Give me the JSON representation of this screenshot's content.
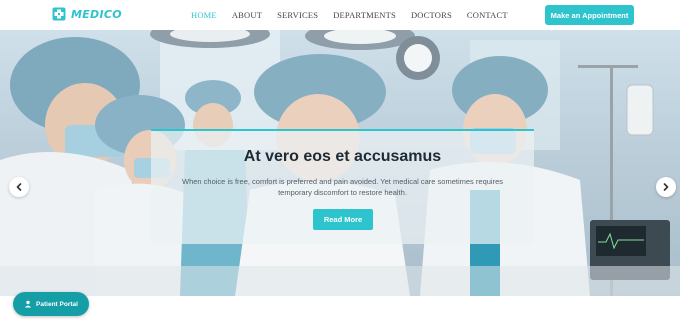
{
  "brand": {
    "name": "MEDICO"
  },
  "nav": {
    "items": [
      {
        "label": "HOME",
        "active": true
      },
      {
        "label": "ABOUT",
        "active": false
      },
      {
        "label": "SERVICES",
        "active": false
      },
      {
        "label": "DEPARTMENTS",
        "active": false
      },
      {
        "label": "DOCTORS",
        "active": false
      },
      {
        "label": "CONTACT",
        "active": false
      }
    ],
    "cta_label": "Make an Appointment"
  },
  "hero": {
    "title": "At vero eos et accusamus",
    "text": "When choice is free, comfort is preferred and pain avoided. Yet medical care sometimes requires temporary discomfort to restore health.",
    "button_label": "Read More",
    "prev_icon": "chevron-left-icon",
    "next_icon": "chevron-right-icon"
  },
  "portal": {
    "label": "Patient Portal",
    "icon": "user-icon"
  },
  "colors": {
    "accent": "#2ec4cd",
    "accent_dark": "#159ea6",
    "text_dark": "#1e2b34"
  }
}
